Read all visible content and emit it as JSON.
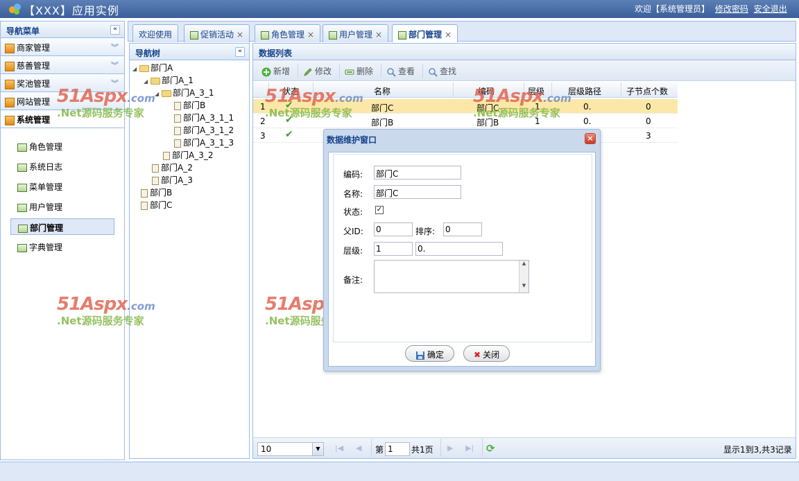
{
  "header": {
    "app_title": "【XXX】应用实例",
    "welcome_text": "欢迎【系统管理员】",
    "change_password": "修改密码",
    "logout": "安全退出"
  },
  "west": {
    "title": "导航菜单",
    "accordion": [
      {
        "label": "商家管理"
      },
      {
        "label": "慈善管理"
      },
      {
        "label": "奖池管理"
      },
      {
        "label": "网站管理"
      },
      {
        "label": "系统管理"
      }
    ],
    "menu_items": [
      {
        "label": "角色管理"
      },
      {
        "label": "系统日志"
      },
      {
        "label": "菜单管理"
      },
      {
        "label": "用户管理"
      },
      {
        "label": "部门管理"
      },
      {
        "label": "字典管理"
      }
    ]
  },
  "tabs": [
    {
      "label": "欢迎使用"
    },
    {
      "label": "促销活动"
    },
    {
      "label": "角色管理"
    },
    {
      "label": "用户管理"
    },
    {
      "label": "部门管理"
    }
  ],
  "tree": {
    "title": "导航树",
    "nodes": [
      {
        "label": "部门A"
      },
      {
        "label": "部门A_1"
      },
      {
        "label": "部门A_3_1"
      },
      {
        "label": "部门B"
      },
      {
        "label": "部门A_3_1_1"
      },
      {
        "label": "部门A_3_1_2"
      },
      {
        "label": "部门A_3_1_3"
      },
      {
        "label": "部门A_3_2"
      },
      {
        "label": "部门A_2"
      },
      {
        "label": "部门A_3"
      },
      {
        "label": "部门B"
      },
      {
        "label": "部门C"
      }
    ]
  },
  "grid": {
    "title": "数据列表",
    "toolbar": {
      "add": "新增",
      "edit": "修改",
      "delete": "删除",
      "view": "查看",
      "search": "查找"
    },
    "columns": [
      "状态",
      "名称",
      "编码",
      "层级",
      "层级路径",
      "子节点个数"
    ],
    "rows": [
      {
        "index": "1",
        "name": "部门C",
        "code": "部门C",
        "level": "1",
        "path": "0.",
        "children": "0"
      },
      {
        "index": "2",
        "name": "部门B",
        "code": "部门B",
        "level": "1",
        "path": "0.",
        "children": "0"
      },
      {
        "index": "3",
        "name": "",
        "code": "",
        "level": "",
        "path": "",
        "children": "3"
      }
    ],
    "pager": {
      "page_size": "10",
      "page_prefix": "第",
      "page_value": "1",
      "page_total": "共1页",
      "display": "显示1到3,共3记录"
    }
  },
  "dialog": {
    "title": "数据维护窗口",
    "code_label": "编码:",
    "code_value": "部门C",
    "name_label": "名称:",
    "name_value": "部门C",
    "status_label": "状态:",
    "status_checked": "✓",
    "parent_label": "父ID:",
    "parent_value": "0",
    "sort_label": "排序:",
    "sort_value": "0",
    "level_label": "层级:",
    "level_value": "1",
    "path_value": "0.",
    "remark_label": "备注:",
    "ok_button": "确定",
    "close_button": "关闭"
  },
  "watermark": {
    "brand": "51Aspx",
    "domain": ".com",
    "slogan": ".Net源码服务专家"
  },
  "colors": {
    "header": "#3a5f99",
    "panel_border": "#99bbe8",
    "selected_row": "#fbe8a8",
    "check": "#3c9d2f"
  }
}
